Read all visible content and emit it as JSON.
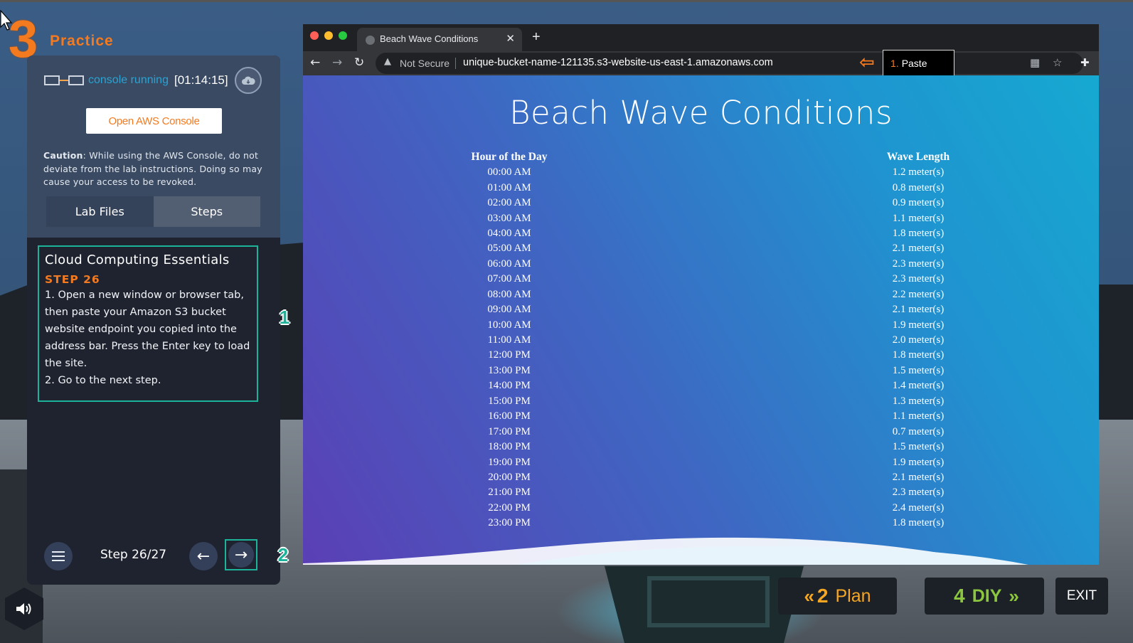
{
  "phase": {
    "number": "3",
    "title": "Practice"
  },
  "console": {
    "status_label": "console running",
    "timer": "[01:14:15]",
    "open_button": "Open AWS Console"
  },
  "caution": {
    "label": "Caution",
    "text": ": While using the AWS Console, do not deviate from the lab instructions. Doing so may cause your access to be revoked."
  },
  "tabs": {
    "lab_files": "Lab Files",
    "steps": "Steps"
  },
  "step": {
    "course": "Cloud Computing Essentials",
    "label": "STEP 26",
    "line1": "1. Open a new window or browser tab, then paste your Amazon S3 bucket website endpoint you copied into the address bar. Press the Enter key to load the site.",
    "line2": "2. Go to the next step."
  },
  "badges": {
    "b1": "1",
    "b2": "2"
  },
  "footer": {
    "step_count": "Step 26/27"
  },
  "browser": {
    "tab_title": "Beach Wave Conditions",
    "not_secure": "Not Secure",
    "url": "unique-bucket-name-121135.s3-website-us-east-1.amazonaws.com",
    "paste_num": "1.",
    "paste_label": "Paste"
  },
  "page": {
    "title": "Beach Wave Conditions",
    "col1": "Hour of the Day",
    "col2": "Wave Length",
    "rows": [
      [
        "00:00 AM",
        "1.2 meter(s)"
      ],
      [
        "01:00 AM",
        "0.8 meter(s)"
      ],
      [
        "02:00 AM",
        "0.9 meter(s)"
      ],
      [
        "03:00 AM",
        "1.1 meter(s)"
      ],
      [
        "04:00 AM",
        "1.8 meter(s)"
      ],
      [
        "05:00 AM",
        "2.1 meter(s)"
      ],
      [
        "06:00 AM",
        "2.3 meter(s)"
      ],
      [
        "07:00 AM",
        "2.3 meter(s)"
      ],
      [
        "08:00 AM",
        "2.2 meter(s)"
      ],
      [
        "09:00 AM",
        "2.1 meter(s)"
      ],
      [
        "10:00 AM",
        "1.9 meter(s)"
      ],
      [
        "11:00 AM",
        "2.0 meter(s)"
      ],
      [
        "12:00 PM",
        "1.8 meter(s)"
      ],
      [
        "13:00 PM",
        "1.5 meter(s)"
      ],
      [
        "14:00 PM",
        "1.4 meter(s)"
      ],
      [
        "15:00 PM",
        "1.3 meter(s)"
      ],
      [
        "16:00 PM",
        "1.1 meter(s)"
      ],
      [
        "17:00 PM",
        "0.7 meter(s)"
      ],
      [
        "18:00 PM",
        "1.5 meter(s)"
      ],
      [
        "19:00 PM",
        "1.9 meter(s)"
      ],
      [
        "20:00 PM",
        "2.1 meter(s)"
      ],
      [
        "21:00 PM",
        "2.3 meter(s)"
      ],
      [
        "22:00 PM",
        "2.4 meter(s)"
      ],
      [
        "23:00 PM",
        "1.8 meter(s)"
      ]
    ]
  },
  "nav": {
    "plan_num": "2",
    "plan_label": "Plan",
    "diy_num": "4",
    "diy_label": "DIY",
    "exit_label": "EXIT"
  },
  "colors": {
    "accent_orange": "#f47a1f",
    "highlight_teal": "#1db39a",
    "plan_gold": "#f5a623",
    "diy_green": "#8cc63f"
  }
}
